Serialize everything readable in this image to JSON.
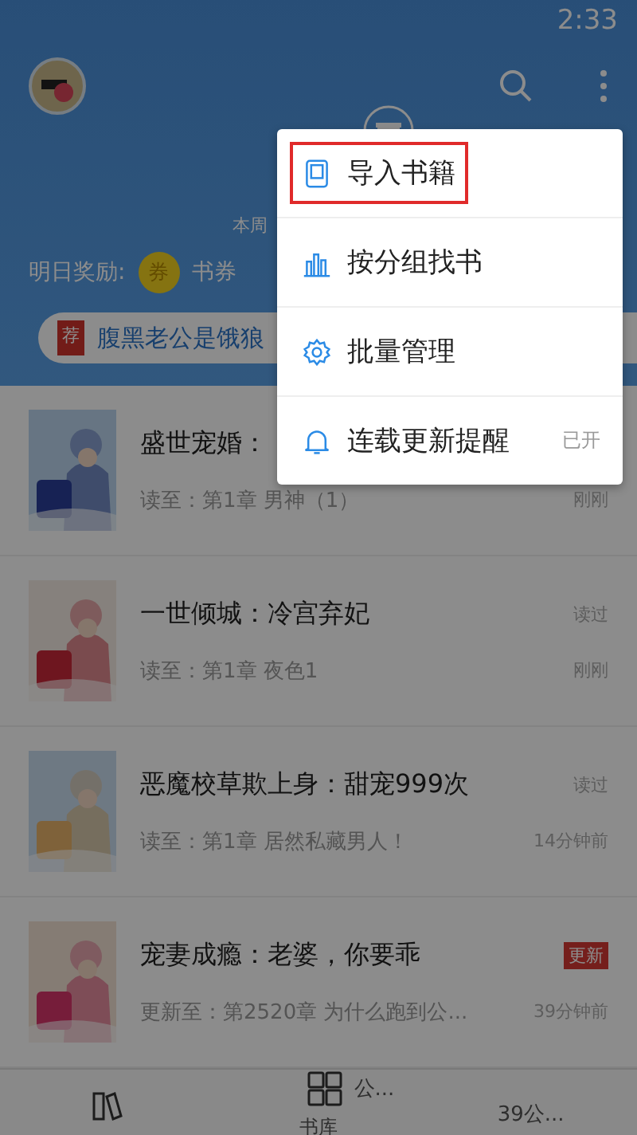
{
  "status_bar": {
    "time": "2:33"
  },
  "header": {
    "week_label": "本周",
    "reward_label": "明日奖励:",
    "coin": "券",
    "reward": "书券"
  },
  "banner": {
    "tag": "荐",
    "title": "腹黑老公是饿狼"
  },
  "books": [
    {
      "title": "盛世宠婚：",
      "progress": "读至：第1章 男神（1）",
      "time": "刚刚"
    },
    {
      "title": "一世倾城：冷宫弃妃",
      "progress": "读至：第1章 夜色1",
      "tag": "读过",
      "tag_new": false,
      "time": "刚刚"
    },
    {
      "title": "恶魔校草欺上身：甜宠999次",
      "progress": "读至：第1章 居然私藏男人！",
      "tag": "读过",
      "tag_new": false,
      "time": "14分钟前"
    },
    {
      "title": "宠妻成瘾：老婆，你要乖",
      "progress": "更新至：第2520章 为什么跑到公...",
      "tag": "更新",
      "tag_new": true,
      "time": "39分钟前"
    }
  ],
  "menu": [
    {
      "kind": "import",
      "label": "导入书籍",
      "highlighted": true
    },
    {
      "kind": "group",
      "label": "按分组找书",
      "highlighted": false
    },
    {
      "kind": "manage",
      "label": "批量管理",
      "highlighted": false
    },
    {
      "kind": "remind",
      "label": "连载更新提醒",
      "highlighted": false,
      "value": "已开"
    }
  ],
  "bottom_nav": [
    {
      "kind": "shelf"
    },
    {
      "kind": "store",
      "label": "书库",
      "toast": "公..."
    },
    {
      "kind": "other",
      "toast": "39公..."
    }
  ]
}
